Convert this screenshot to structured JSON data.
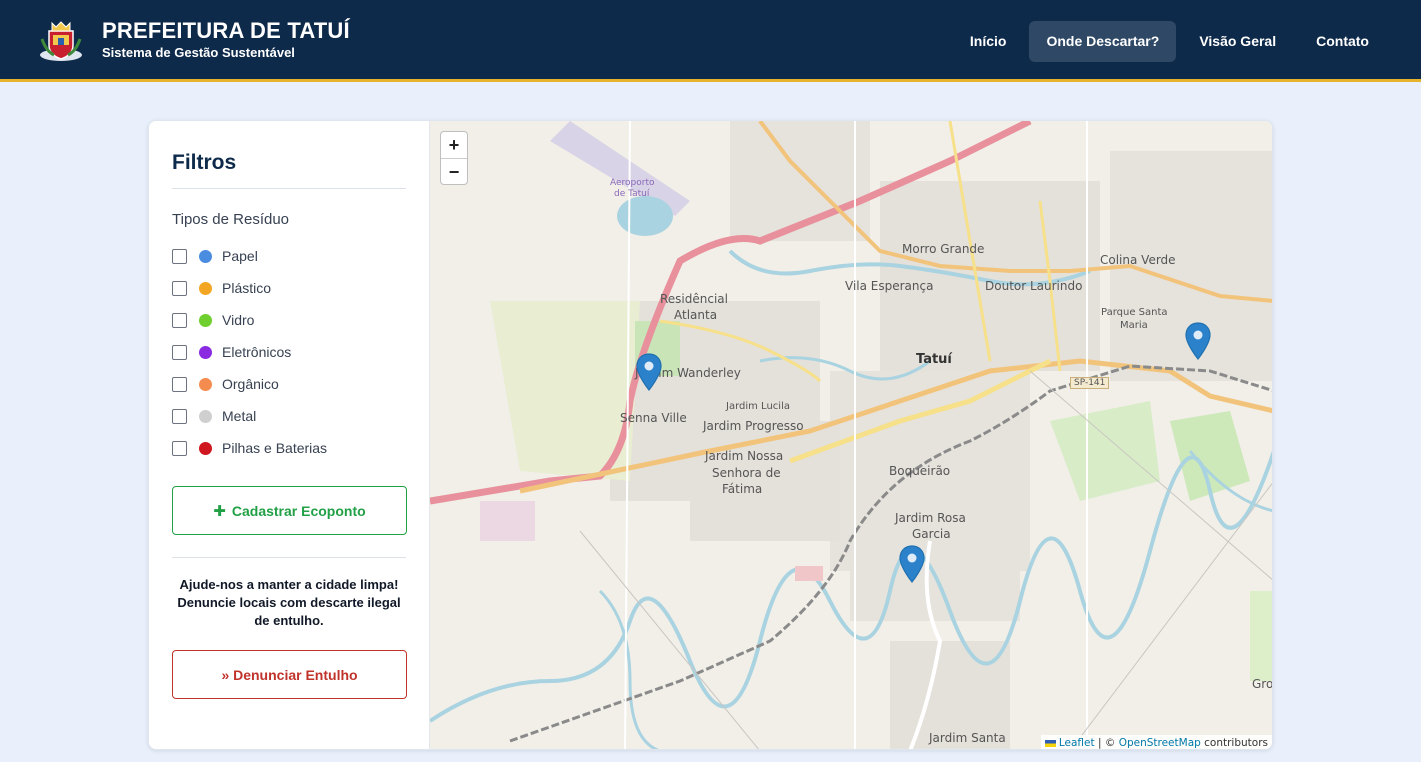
{
  "header": {
    "title": "PREFEITURA DE TATUÍ",
    "subtitle": "Sistema de Gestão Sustentável",
    "nav": [
      "Início",
      "Onde Descartar?",
      "Visão Geral",
      "Contato"
    ],
    "active_nav": "Onde Descartar?"
  },
  "sidebar": {
    "title": "Filtros",
    "section_label": "Tipos de Resíduo",
    "filters": [
      {
        "label": "Papel",
        "color": "#4a8de0",
        "checked": false
      },
      {
        "label": "Plástico",
        "color": "#f3a623",
        "checked": false
      },
      {
        "label": "Vidro",
        "color": "#6fcf2f",
        "checked": false
      },
      {
        "label": "Eletrônicos",
        "color": "#8a2be2",
        "checked": false
      },
      {
        "label": "Orgânico",
        "color": "#f48c4f",
        "checked": false
      },
      {
        "label": "Metal",
        "color": "#cfcfcf",
        "checked": false
      },
      {
        "label": "Pilhas e Baterias",
        "color": "#d0161f",
        "checked": false
      }
    ],
    "register_button": "Cadastrar Ecoponto",
    "help_text": "Ajude-nos a manter a cidade limpa! Denuncie locais com descarte ilegal de entulho.",
    "report_button": "» Denunciar Entulho"
  },
  "map": {
    "zoom_in": "+",
    "zoom_out": "−",
    "attribution_leaflet": "Leaflet",
    "attribution_sep": " | © ",
    "attribution_osm": "OpenStreetMap",
    "attribution_tail": " contributors",
    "labels": [
      {
        "text": "Tatuí",
        "key": "tatui"
      },
      {
        "text": "Morro Grande",
        "key": "morro"
      },
      {
        "text": "Colina Verde",
        "key": "colina"
      },
      {
        "text": "Vila Esperança",
        "key": "esperanca"
      },
      {
        "text": "Doutor Laurindo",
        "key": "laurindo"
      },
      {
        "text": "Residêncial",
        "key": "resid1"
      },
      {
        "text": "Atlanta",
        "key": "resid2"
      },
      {
        "text": "Jardim Wanderley",
        "key": "wanderley"
      },
      {
        "text": "Jardim Lucila",
        "key": "lucila"
      },
      {
        "text": "Senna Ville",
        "key": "senna"
      },
      {
        "text": "Jardim Progresso",
        "key": "progresso"
      },
      {
        "text": "Jardim Nossa",
        "key": "nossa1"
      },
      {
        "text": "Senhora de",
        "key": "nossa2"
      },
      {
        "text": "Fátima",
        "key": "nossa3"
      },
      {
        "text": "Boqueirão",
        "key": "boqueirao"
      },
      {
        "text": "Jardim Rosa",
        "key": "rosa1"
      },
      {
        "text": "Garcia",
        "key": "rosa2"
      },
      {
        "text": "Parque Santa",
        "key": "psm1"
      },
      {
        "text": "Maria",
        "key": "psm2"
      },
      {
        "text": "SP-141",
        "key": "sp141"
      },
      {
        "text": "Aeroporto",
        "key": "aero1"
      },
      {
        "text": "de Tatuí",
        "key": "aero2"
      },
      {
        "text": "Jardim Santa",
        "key": "santa"
      },
      {
        "text": "Gro",
        "key": "gro"
      }
    ]
  }
}
